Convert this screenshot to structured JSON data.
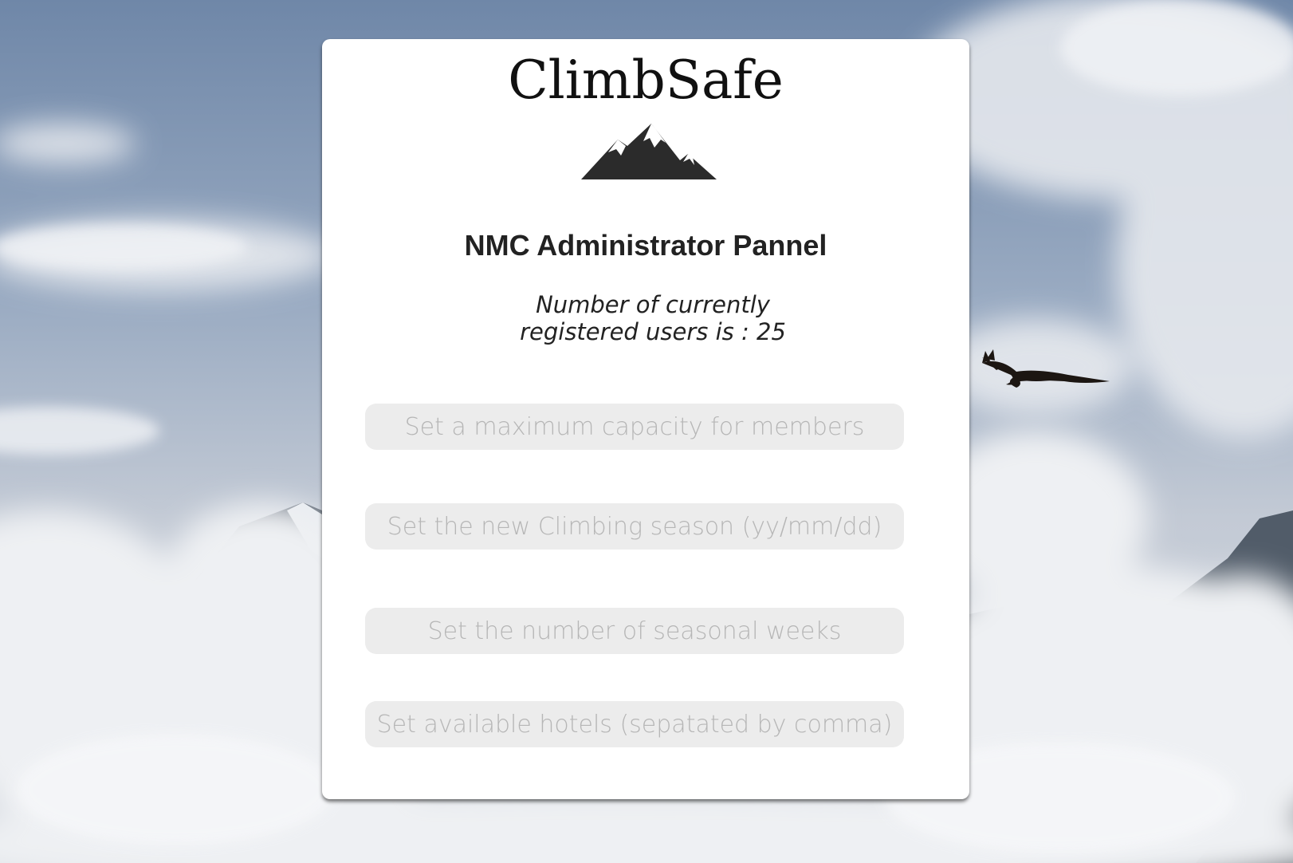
{
  "app": {
    "title": "ClimbSafe",
    "logo_icon": "mountain-icon"
  },
  "panel": {
    "heading": "NMC Administrator Pannel",
    "user_count_text": "Number of currently registered users is : 25"
  },
  "form": {
    "max_capacity": {
      "value": "",
      "placeholder": "Set a maximum capacity for members"
    },
    "climbing_season": {
      "value": "",
      "placeholder": "Set the new Climbing season (yy/mm/dd)"
    },
    "seasonal_weeks": {
      "value": "",
      "placeholder": "Set the number of seasonal weeks"
    },
    "hotels": {
      "value": "",
      "placeholder": "Set available hotels (sepatated by comma)"
    }
  },
  "colors": {
    "panel_bg": "#ffffff",
    "field_bg": "#ececec",
    "placeholder": "#b6b6b6",
    "text": "#222222"
  }
}
